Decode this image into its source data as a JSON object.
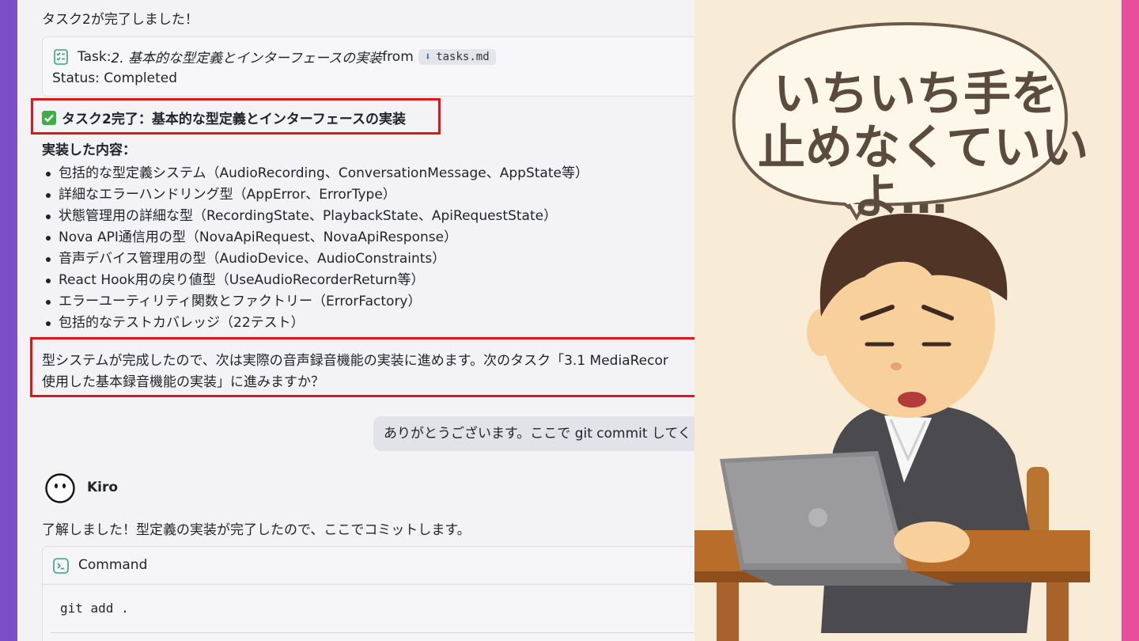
{
  "chat": {
    "intro": "タスク2が完了しました！",
    "task_card": {
      "prefix": "Task: ",
      "task_name": "2. 基本的な型定義とインターフェースの実装",
      "from_label": " from",
      "file_chip": "tasks.md",
      "status": "Status: Completed"
    },
    "heading": "タスク2完了：基本的な型定義とインターフェースの実装",
    "section_label": "実装した内容：",
    "bullets": [
      "包括的な型定義システム（AudioRecording、ConversationMessage、AppState等）",
      "詳細なエラーハンドリング型（AppError、ErrorType）",
      "状態管理用の詳細な型（RecordingState、PlaybackState、ApiRequestState）",
      "Nova API通信用の型（NovaApiRequest、NovaApiResponse）",
      "音声デバイス管理用の型（AudioDevice、AudioConstraints）",
      "React Hook用の戻り値型（UseAudioRecorderReturn等）",
      "エラーユーティリティ関数とファクトリー（ErrorFactory）",
      "包括的なテストカバレッジ（22テスト）"
    ],
    "next_line1": "型システムが完成したので、次は実際の音声録音機能の実装に進めます。次のタスク「3.1 MediaRecor",
    "next_line2": "使用した基本録音機能の実装」に進みますか？",
    "user_message": "ありがとうございます。ここで git commit してく",
    "assistant_name": "Kiro",
    "assistant_reply": "了解しました！型定義の実装が完了したので、ここでコミットします。",
    "command_card": {
      "title": "Command",
      "code": "git add ."
    }
  },
  "illustration": {
    "speech_line1": "いちいち手を",
    "speech_line2": "止めなくていい",
    "speech_line3": "よ…"
  },
  "colors": {
    "highlight_border": "#e0161b",
    "panel_bg": "#f3f3f6",
    "illustration_bg": "#f9ecd7"
  }
}
